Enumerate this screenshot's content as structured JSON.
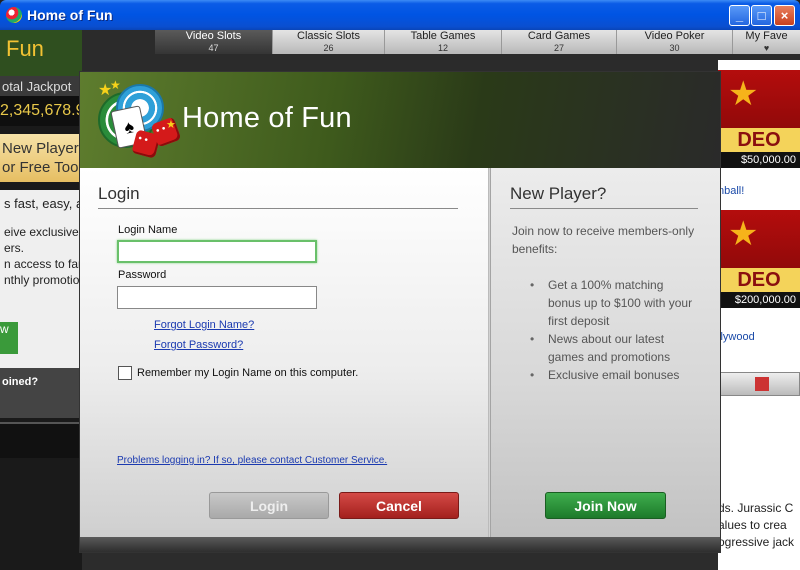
{
  "window": {
    "title": "Home of Fun",
    "controls": [
      "_",
      "□",
      "×"
    ]
  },
  "background": {
    "brand": "Fun",
    "jackpot_label": "otal Jackpot",
    "jackpot_value": "2,345,678.9",
    "new_player_line1": "New Player?",
    "new_player_line2": "or Free Too",
    "promo_lines": [
      "s fast, easy, a",
      "eive exclusive",
      "ers.",
      "n access to fan",
      "nthly promotio"
    ],
    "green_btn": "w",
    "joined": "oined?",
    "tabs": [
      {
        "label": "Video Slots",
        "count": "47"
      },
      {
        "label": "Classic Slots",
        "count": "26"
      },
      {
        "label": "Table Games",
        "count": "12"
      },
      {
        "label": "Card Games",
        "count": "27"
      },
      {
        "label": "Video Poker",
        "count": "30"
      },
      {
        "label": "My Fave",
        "count": ""
      }
    ],
    "slots": [
      {
        "label": "DEO SLO",
        "amount": "$50,000.00",
        "link": "nball!"
      },
      {
        "label": "DEO SLO",
        "amount": "$200,000.00",
        "link": "llywood"
      }
    ],
    "desc_lines": [
      "ds. Jurassic C",
      "alues to crea",
      "ogressive jack"
    ]
  },
  "dialog": {
    "title": "Home of Fun",
    "login": {
      "heading": "Login",
      "login_name_label": "Login Name",
      "login_name_value": "",
      "password_label": "Password",
      "password_value": "",
      "forgot_login": "Forgot Login Name?",
      "forgot_password": "Forgot Password?",
      "remember_label": "Remember my Login Name on this computer.",
      "remember_checked": false,
      "problems_link": "Problems logging in? If so, please contact Customer Service.",
      "login_button": "Login",
      "cancel_button": "Cancel"
    },
    "new_player": {
      "heading": "New Player?",
      "intro": "Join now to receive members-only benefits:",
      "benefits": [
        "Get a 100% matching bonus up to $100 with your first deposit",
        "News about our latest games and promotions",
        "Exclusive email bonuses"
      ],
      "join_button": "Join Now"
    }
  },
  "colors": {
    "titlebar": "#0054e3",
    "header_green": "#3e5a1c",
    "focus_green": "#69c06a",
    "cancel_red": "#a3201d",
    "join_green": "#1d7a2a",
    "link_blue": "#1b3ab0"
  }
}
